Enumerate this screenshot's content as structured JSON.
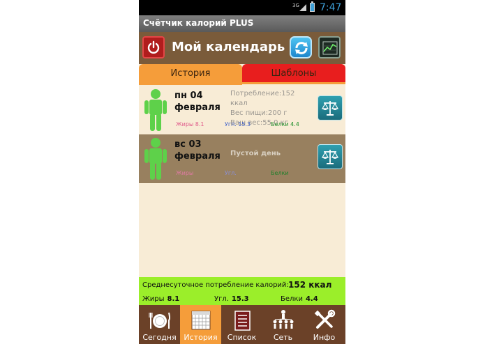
{
  "status_bar": {
    "network": "3G",
    "time": "7:47"
  },
  "app_title": "Счётчик калорий PLUS",
  "header": {
    "title": "Мой календарь"
  },
  "tabs": [
    {
      "label": "История",
      "active": true
    },
    {
      "label": "Шаблоны",
      "active": false
    }
  ],
  "days": [
    {
      "date_line1": "пн 04",
      "date_line2": "февраля",
      "consumption": "Потребление:152 ккал",
      "food_weight": "Вес пищи:200 г",
      "your_weight": "Ваш вес:55.0 кг",
      "fat": "Жиры  8.1",
      "carbs": "Угл.  15.3",
      "protein": "Белки  4.4"
    },
    {
      "date_line1": "вс 03",
      "date_line2": "февраля",
      "empty_label": "Пустой день",
      "fat": "Жиры",
      "carbs": "Угл.",
      "protein": "Белки"
    }
  ],
  "summary": {
    "avg_label": "Среднесуточное потребление калорий:",
    "avg_value": "152 ккал",
    "fat_label": "Жиры",
    "fat_value": "8.1",
    "carbs_label": "Угл.",
    "carbs_value": "15.3",
    "protein_label": "Белки",
    "protein_value": "4.4"
  },
  "nav": [
    {
      "label": "Сегодня",
      "icon": "plate-icon",
      "active": false
    },
    {
      "label": "История",
      "icon": "calendar-icon",
      "active": true
    },
    {
      "label": "Список",
      "icon": "list-icon",
      "active": false
    },
    {
      "label": "Сеть",
      "icon": "network-icon",
      "active": false
    },
    {
      "label": "Инфо",
      "icon": "tools-icon",
      "active": false
    }
  ],
  "colors": {
    "header_brown": "#7a5b3a",
    "tab_active": "#f59d3a",
    "tab_inactive": "#e81e1e",
    "summary_green": "#9bee2a",
    "nav_brown": "#6b4128",
    "person_green": "#5ed14a"
  }
}
